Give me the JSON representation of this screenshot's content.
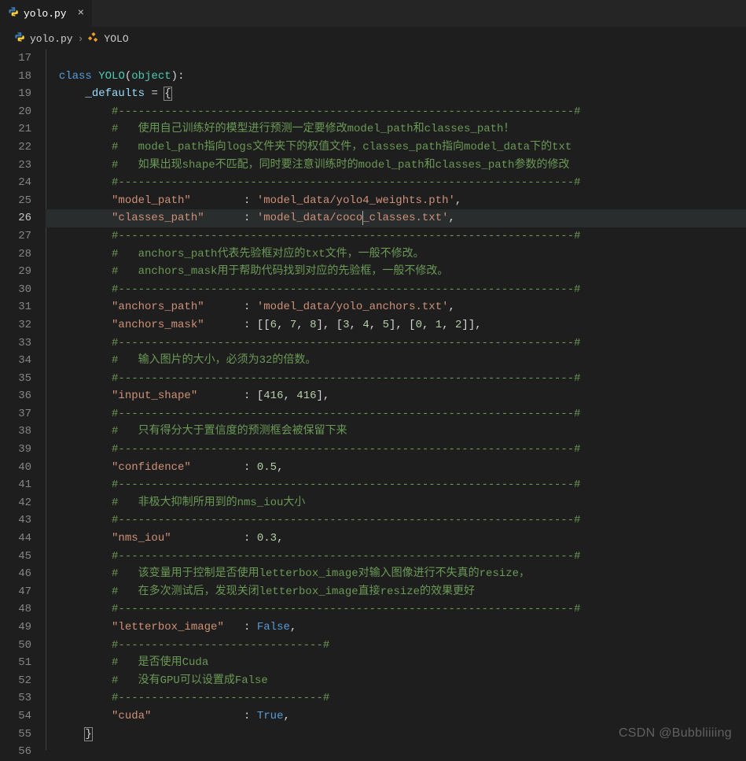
{
  "tab": {
    "label": "yolo.py"
  },
  "breadcrumb": {
    "file": "yolo.py",
    "symbol": "YOLO"
  },
  "lines": {
    "start": 17,
    "active": 26
  },
  "code": {
    "l18": {
      "kw_class": "class",
      "cls_yolo": "YOLO",
      "cls_obj": "object"
    },
    "l19": {
      "var": "_defaults"
    },
    "l20": "#---------------------------------------------------------------------#",
    "l21": "#   使用自己训练好的模型进行预测一定要修改model_path和classes_path！",
    "l22": "#   model_path指向logs文件夹下的权值文件，classes_path指向model_data下的txt",
    "l23": "#   如果出现shape不匹配，同时要注意训练时的model_path和classes_path参数的修改",
    "l24": "#---------------------------------------------------------------------#",
    "l25": {
      "key": "\"model_path\"",
      "sep": "        : ",
      "val": "'model_data/yolo4_weights.pth'"
    },
    "l26": {
      "key": "\"classes_path\"",
      "sep": "      : ",
      "val1": "'model_data/coco",
      "val2": "_classes.txt'"
    },
    "l27": "#---------------------------------------------------------------------#",
    "l28": "#   anchors_path代表先验框对应的txt文件，一般不修改。",
    "l29": "#   anchors_mask用于帮助代码找到对应的先验框，一般不修改。",
    "l30": "#---------------------------------------------------------------------#",
    "l31": {
      "key": "\"anchors_path\"",
      "sep": "      : ",
      "val": "'model_data/yolo_anchors.txt'"
    },
    "l32": {
      "key": "\"anchors_mask\"",
      "sep": "      : ",
      "nums": [
        "6",
        "7",
        "8",
        "3",
        "4",
        "5",
        "0",
        "1",
        "2"
      ]
    },
    "l33": "#---------------------------------------------------------------------#",
    "l34": "#   输入图片的大小，必须为32的倍数。",
    "l35": "#---------------------------------------------------------------------#",
    "l36": {
      "key": "\"input_shape\"",
      "sep": "       : ",
      "n1": "416",
      "n2": "416"
    },
    "l37": "#---------------------------------------------------------------------#",
    "l38": "#   只有得分大于置信度的预测框会被保留下来",
    "l39": "#---------------------------------------------------------------------#",
    "l40": {
      "key": "\"confidence\"",
      "sep": "        : ",
      "val": "0.5"
    },
    "l41": "#---------------------------------------------------------------------#",
    "l42": "#   非极大抑制所用到的nms_iou大小",
    "l43": "#---------------------------------------------------------------------#",
    "l44": {
      "key": "\"nms_iou\"",
      "sep": "           : ",
      "val": "0.3"
    },
    "l45": "#---------------------------------------------------------------------#",
    "l46": "#   该变量用于控制是否使用letterbox_image对输入图像进行不失真的resize，",
    "l47": "#   在多次测试后，发现关闭letterbox_image直接resize的效果更好",
    "l48": "#---------------------------------------------------------------------#",
    "l49": {
      "key": "\"letterbox_image\"",
      "sep": "   : ",
      "val": "False"
    },
    "l50": "#-------------------------------#",
    "l51": "#   是否使用Cuda",
    "l52": "#   没有GPU可以设置成False",
    "l53": "#-------------------------------#",
    "l54": {
      "key": "\"cuda\"",
      "sep": "              : ",
      "val": "True"
    }
  },
  "watermark": "CSDN @Bubbliiiing"
}
